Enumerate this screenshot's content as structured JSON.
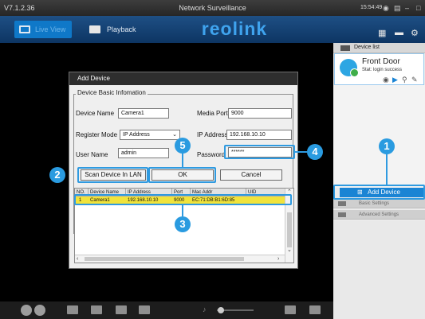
{
  "window": {
    "version": "V7.1.2.36",
    "title": "Network Surveillance",
    "clock": "15:54:49",
    "sys_icons": [
      "network-icon",
      "monitor-icon",
      "minimize-icon",
      "maximize-icon"
    ]
  },
  "header": {
    "tabs": [
      {
        "label": "Live View",
        "active": true,
        "icon": "live-view-icon"
      },
      {
        "label": "Playback",
        "active": false,
        "icon": "playback-icon"
      }
    ],
    "logo": "reolink",
    "right_icons": [
      "layout-icon",
      "menu-icon",
      "settings-icon"
    ]
  },
  "sidebar": {
    "device_list_label": "Device list",
    "devices": [
      {
        "name": "Front Door",
        "status": "Stat: login success",
        "icon": "camera-icon",
        "tools": [
          "record-icon",
          "play-icon",
          "search-icon",
          "edit-icon"
        ]
      }
    ],
    "add_device_label": "Add Device",
    "menu": [
      {
        "label": "Basic Settings",
        "icon": "basic-settings-icon"
      },
      {
        "label": "Advanced Settings",
        "icon": "advanced-settings-icon"
      }
    ]
  },
  "dialog": {
    "title": "Add Device",
    "section_label": "Device Basic Infomation",
    "fields": {
      "device_name_label": "Device Name",
      "device_name_value": "Camera1",
      "media_port_label": "Media Port",
      "media_port_value": "9000",
      "register_mode_label": "Register Mode",
      "register_mode_value": "IP Address",
      "ip_address_label": "IP Address",
      "ip_address_value": "192.168.10.10",
      "user_name_label": "User Name",
      "user_name_value": "admin",
      "password_label": "Password",
      "password_value": "******"
    },
    "buttons": {
      "scan": "Scan Device In LAN",
      "ok": "OK",
      "cancel": "Cancel"
    }
  },
  "scan_table": {
    "columns": [
      "NO.",
      "Device Name",
      "IP Address",
      "Port",
      "Mac Addr",
      "UID"
    ],
    "rows": [
      [
        "1",
        "Camera1",
        "192.168.10.10",
        "9000",
        "EC:71:DB:B1:6D:85",
        ""
      ]
    ],
    "selected_row": 0
  },
  "callouts": [
    "1",
    "2",
    "3",
    "4",
    "5"
  ],
  "bottom_toolbar": {
    "icons": [
      "play-all-icon",
      "stop-all-icon",
      "record-all-icon",
      "screenshot-icon",
      "snapshot-icon",
      "video-icon",
      "volume-icon",
      "layout-grid-icon",
      "fullscreen-icon"
    ],
    "volume_level": 0.1
  },
  "colors": {
    "accent": "#2a9be0",
    "header_bg": "#0d3563",
    "selected_row": "#f1e33b",
    "add_device_bg": "#1a84d4"
  }
}
